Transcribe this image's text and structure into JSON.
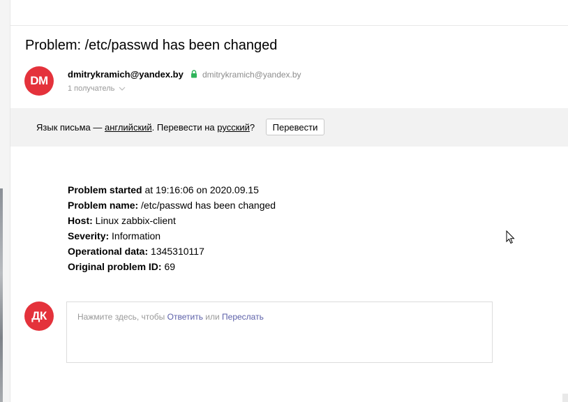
{
  "email": {
    "subject": "Problem: /etc/passwd has been changed",
    "sender": {
      "avatar_initials": "DM",
      "name": "dmitrykramich@yandex.by",
      "email": "dmitrykramich@yandex.by",
      "recipients": "1 получатель"
    },
    "translate": {
      "prefix": "Язык письма — ",
      "language": "английский",
      "middle": ". Перевести на ",
      "target": "русский",
      "suffix": "?",
      "button_label": "Перевести"
    },
    "body": [
      {
        "label": "Problem started",
        "value": " at 19:16:06 on 2020.09.15"
      },
      {
        "label": "Problem name:",
        "value": " /etc/passwd has been changed"
      },
      {
        "label": "Host:",
        "value": " Linux zabbix-client"
      },
      {
        "label": "Severity:",
        "value": " Information"
      },
      {
        "label": "Operational data:",
        "value": " 1345310117"
      },
      {
        "label": "Original problem ID:",
        "value": " 69"
      }
    ],
    "reply": {
      "avatar_initials": "ДК",
      "prefix": "Нажмите здесь, чтобы ",
      "reply_link": "Ответить",
      "middle": " или ",
      "forward_link": "Переслать"
    }
  },
  "colors": {
    "avatar_bg": "#e4323b",
    "lock_green": "#2fb45a",
    "link_purple": "#5b5fa8"
  },
  "icons": {
    "lock": "lock-icon",
    "recipients_toggle": "chevron-down-icon",
    "pointer": "mouse-cursor-icon"
  }
}
